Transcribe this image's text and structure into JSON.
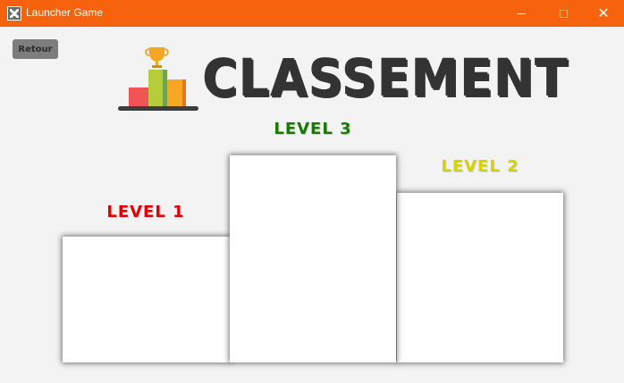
{
  "window": {
    "title": "Launcher Game",
    "icon": "app-icon",
    "controls": {
      "minimize": "minimize-icon",
      "maximize": "maximize-icon",
      "close": "✕"
    }
  },
  "header": {
    "back_label": "Retour",
    "title": "CLASSEMENT",
    "logo_icon": "trophy-podium-icon"
  },
  "podium": {
    "levels": [
      {
        "label": "LEVEL 1",
        "color": "#e00000"
      },
      {
        "label": "LEVEL 3",
        "color": "#1a7a00"
      },
      {
        "label": "LEVEL 2",
        "color": "#d4d400"
      }
    ]
  },
  "colors": {
    "titlebar": "#f7630c",
    "background": "#f3f3f3",
    "button": "#7d7d7d",
    "title_text": "#333333"
  }
}
